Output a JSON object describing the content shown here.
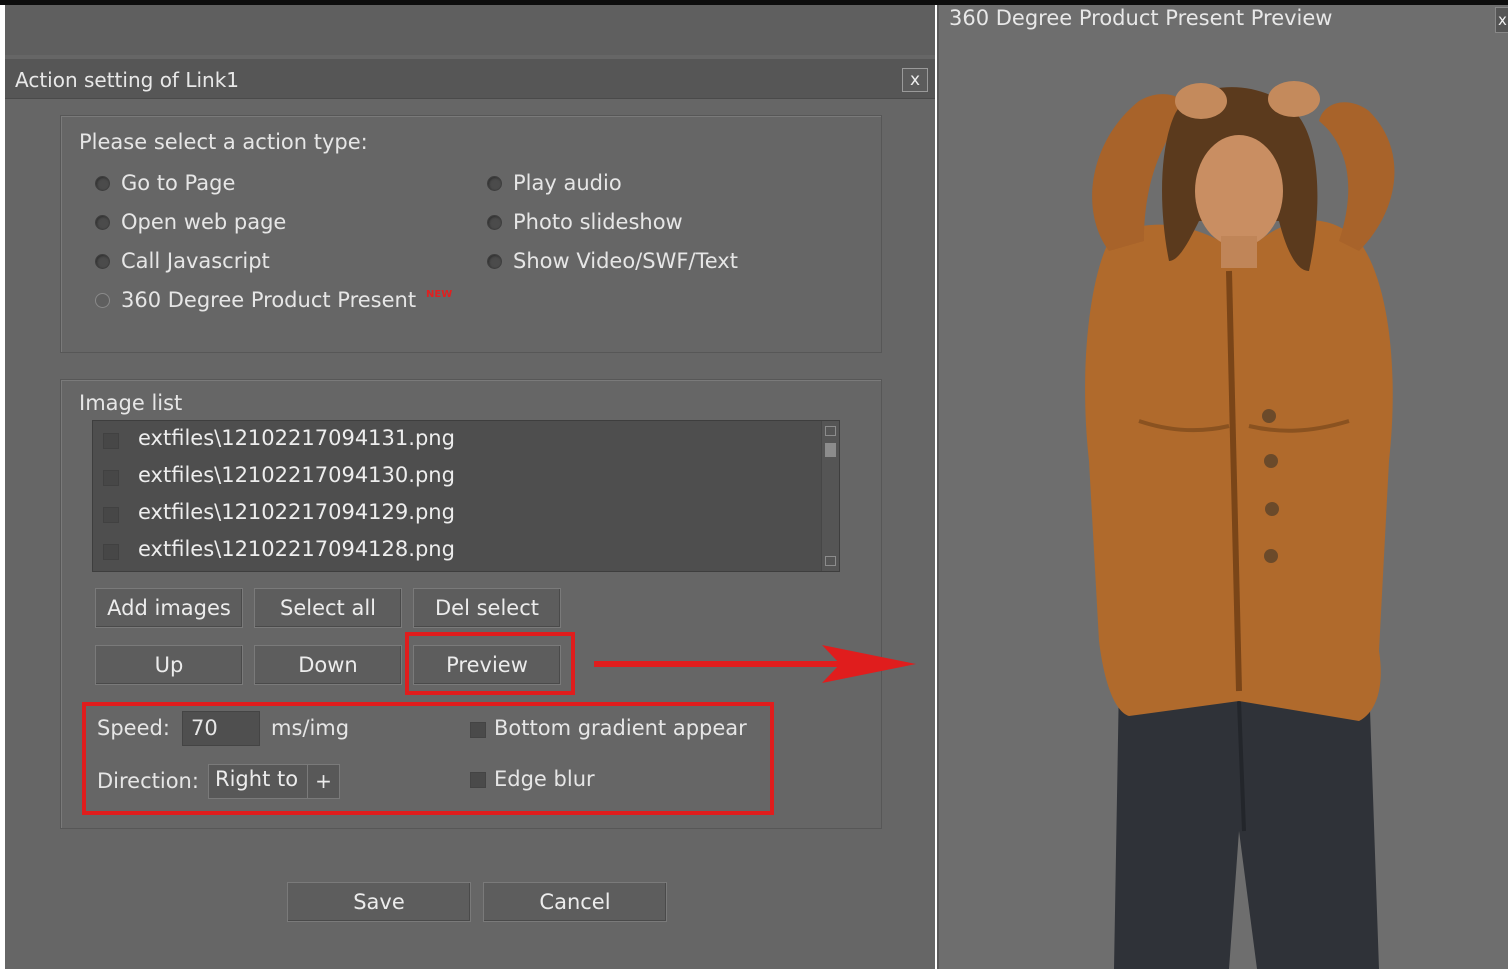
{
  "dialog": {
    "title": "Action setting of Link1",
    "close_label": "x"
  },
  "action_type": {
    "prompt": "Please select a action type:",
    "options": [
      {
        "label": "Go to Page"
      },
      {
        "label": "Open web page"
      },
      {
        "label": "Call Javascript"
      },
      {
        "label": "360 Degree Product Present",
        "badge": "NEW"
      },
      {
        "label": "Play audio"
      },
      {
        "label": "Photo slideshow"
      },
      {
        "label": "Show Video/SWF/Text"
      }
    ]
  },
  "image_list": {
    "label": "Image list",
    "items": [
      "extfiles\\12102217094131.png",
      "extfiles\\12102217094130.png",
      "extfiles\\12102217094129.png",
      "extfiles\\12102217094128.png"
    ]
  },
  "buttons": {
    "add_images": "Add images",
    "select_all": "Select all",
    "del_select": "Del select",
    "up": "Up",
    "down": "Down",
    "preview": "Preview",
    "save": "Save",
    "cancel": "Cancel"
  },
  "settings": {
    "speed_label": "Speed:",
    "speed_value": "70",
    "speed_unit": "ms/img",
    "direction_label": "Direction:",
    "direction_value": "Right to",
    "direction_arrow": "+",
    "bottom_gradient_label": "Bottom gradient appear",
    "edge_blur_label": "Edge blur"
  },
  "preview": {
    "title": "360 Degree Product Present Preview",
    "close_label": "x"
  },
  "colors": {
    "accent_red": "#e01d1d",
    "jacket": "#b06a2c",
    "jeans": "#2f3238"
  },
  "icons": {
    "annotation_arrow": "arrow-right-icon",
    "direction_toggle": "plus-icon"
  }
}
